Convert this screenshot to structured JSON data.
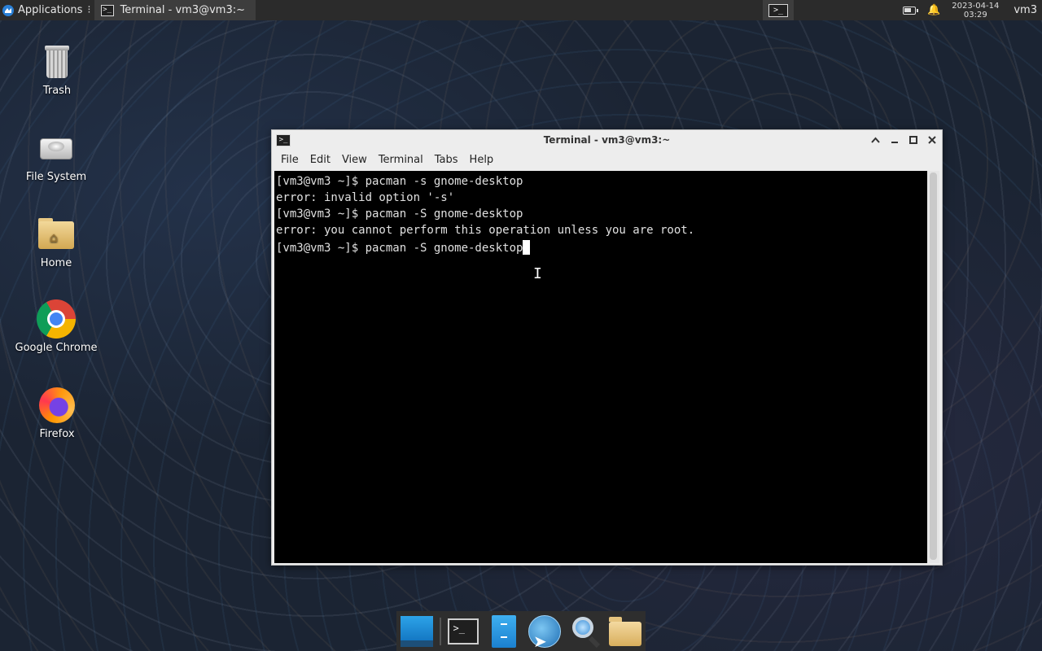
{
  "panel": {
    "applications_label": "Applications",
    "task_title": "Terminal - vm3@vm3:~",
    "clock_date": "2023-04-14",
    "clock_time": "03:29",
    "user": "vm3"
  },
  "desktop": {
    "icons": [
      {
        "label": "Trash",
        "icon": "trash-icon"
      },
      {
        "label": "File System",
        "icon": "drive-icon"
      },
      {
        "label": "Home",
        "icon": "home-folder-icon"
      },
      {
        "label": "Google Chrome",
        "icon": "chrome-icon"
      },
      {
        "label": "Firefox",
        "icon": "firefox-icon"
      }
    ]
  },
  "window": {
    "title": "Terminal - vm3@vm3:~",
    "menu": [
      "File",
      "Edit",
      "View",
      "Terminal",
      "Tabs",
      "Help"
    ],
    "lines": [
      "[vm3@vm3 ~]$ pacman -s gnome-desktop",
      "error: invalid option '-s'",
      "[vm3@vm3 ~]$ pacman -S gnome-desktop",
      "error: you cannot perform this operation unless you are root.",
      "[vm3@vm3 ~]$ pacman -S gnome-desktop"
    ],
    "prompt_glyph": ">_",
    "ibeam_glyph": "I"
  },
  "dock": {
    "items": [
      "show-desktop",
      "terminal",
      "file-manager",
      "web-browser",
      "app-finder",
      "home-folder"
    ]
  },
  "colors": {
    "panel_bg": "#2b2b2b",
    "terminal_bg": "#000000",
    "terminal_fg": "#e0e0e0",
    "window_chrome": "#ededed"
  }
}
